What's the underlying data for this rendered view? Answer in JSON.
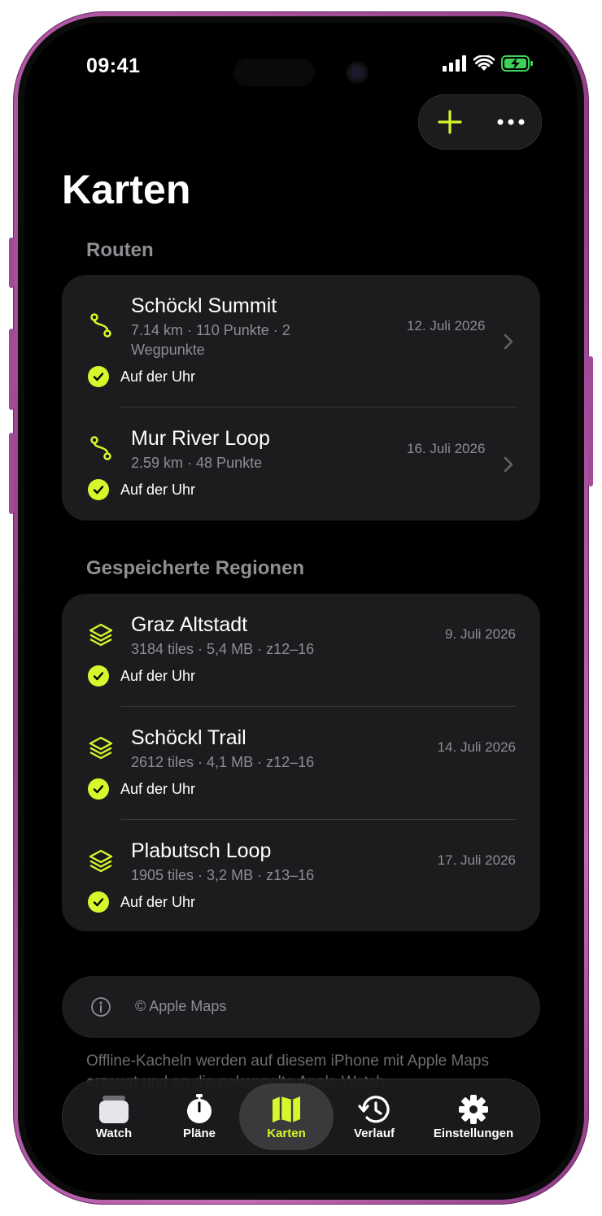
{
  "status_bar": {
    "time": "09:41"
  },
  "header": {
    "title": "Karten"
  },
  "colors": {
    "accent": "#d4f82b",
    "card": "#1c1c1e",
    "secondary_text": "#8e8e93"
  },
  "sections": {
    "routes": {
      "heading": "Routen",
      "items": [
        {
          "title": "Schöckl Summit",
          "subtitle": "7.14 km · 110 Punkte · 2 Wegpunkte",
          "date": "12. Juli 2026",
          "badge": "Auf der Uhr",
          "icon": "route-icon"
        },
        {
          "title": "Mur River Loop",
          "subtitle": "2.59 km · 48 Punkte",
          "date": "16. Juli 2026",
          "badge": "Auf der Uhr",
          "icon": "route-icon"
        }
      ]
    },
    "regions": {
      "heading": "Gespeicherte Regionen",
      "items": [
        {
          "title": "Graz Altstadt",
          "subtitle": "3184 tiles · 5,4 MB · z12–16",
          "date": "9. Juli 2026",
          "badge": "Auf der Uhr",
          "icon": "layers-icon"
        },
        {
          "title": "Schöckl Trail",
          "subtitle": "2612 tiles · 4,1 MB · z12–16",
          "date": "14. Juli 2026",
          "badge": "Auf der Uhr",
          "icon": "layers-icon"
        },
        {
          "title": "Plabutsch Loop",
          "subtitle": "1905 tiles · 3,2 MB · z13–16",
          "date": "17. Juli 2026",
          "badge": "Auf der Uhr",
          "icon": "layers-icon"
        }
      ]
    }
  },
  "credit": {
    "text": "© Apple Maps"
  },
  "footnote": "Offline-Kacheln werden auf diesem iPhone mit Apple Maps erzeugt und an die gekoppelte Apple Watch",
  "tabs": [
    {
      "label": "Watch",
      "icon": "watch-icon"
    },
    {
      "label": "Pläne",
      "icon": "stopwatch-icon"
    },
    {
      "label": "Karten",
      "icon": "map-icon",
      "active": true
    },
    {
      "label": "Verlauf",
      "icon": "history-icon"
    },
    {
      "label": "Einstellungen",
      "icon": "gear-icon"
    }
  ]
}
